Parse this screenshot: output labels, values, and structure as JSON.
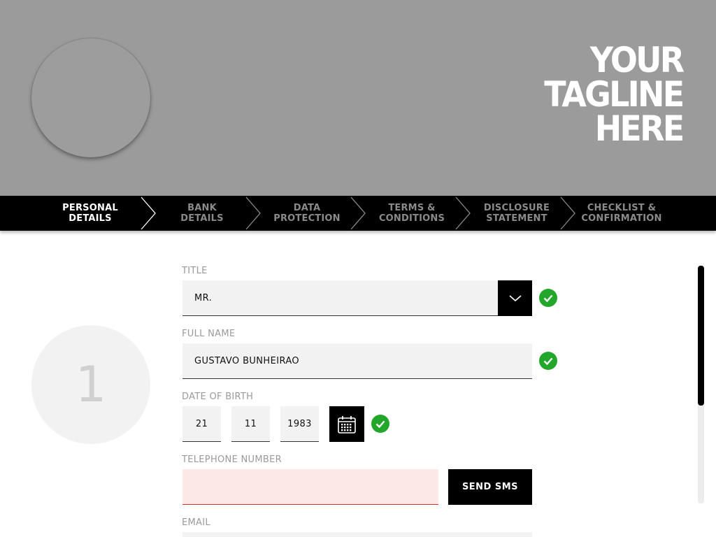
{
  "header": {
    "tagline": [
      "YOUR",
      "TAGLINE",
      "HERE"
    ]
  },
  "steps": [
    {
      "label": "PERSONAL\nDETAILS",
      "active": true
    },
    {
      "label": "BANK\nDETAILS",
      "active": false
    },
    {
      "label": "DATA\nPROTECTION",
      "active": false
    },
    {
      "label": "TERMS &\nCONDITIONS",
      "active": false
    },
    {
      "label": "DISCLOSURE\nSTATEMENT",
      "active": false
    },
    {
      "label": "CHECKLIST &\nCONFIRMATION",
      "active": false
    }
  ],
  "step_number": "1",
  "form": {
    "title": {
      "label": "TITLE",
      "value": "MR."
    },
    "full_name": {
      "label": "FULL NAME",
      "value": "GUSTAVO BUNHEIRAO"
    },
    "dob": {
      "label": "DATE OF BIRTH",
      "day": "21",
      "month": "11",
      "year": "1983"
    },
    "telephone": {
      "label": "TELEPHONE NUMBER",
      "value": "",
      "button": "SEND SMS"
    },
    "email": {
      "label": "EMAIL",
      "value": ""
    }
  },
  "icons": {
    "dropdown": "chevron-down-icon",
    "calendar": "calendar-icon",
    "valid": "check-icon"
  },
  "colors": {
    "header_bg": "#9b9b9b",
    "steps_bg": "#000000",
    "valid": "#23a72b",
    "error_bg": "#fde8e8"
  }
}
